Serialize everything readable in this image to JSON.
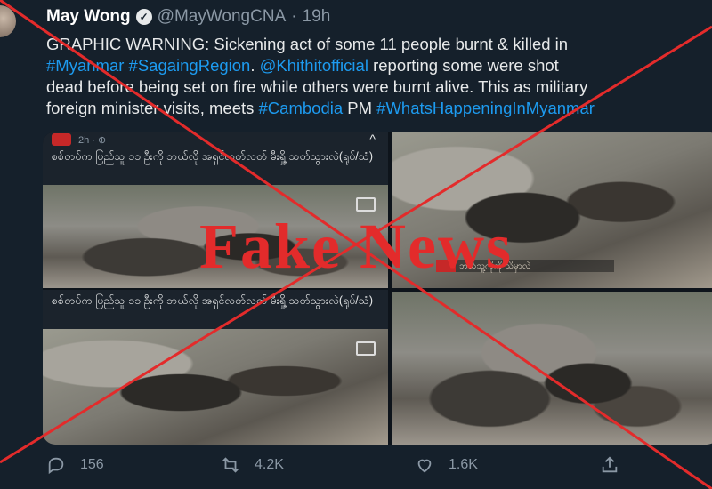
{
  "tweet": {
    "author_name": "May Wong",
    "handle": "@MayWongCNA",
    "separator": "·",
    "time": "19h",
    "verified_glyph": "✓",
    "text_lines": [
      [
        {
          "t": "GRAPHIC WARNING: Sickening act of some 11 people burnt & killed in",
          "link": false
        }
      ],
      [
        {
          "t": "#Myanmar",
          "link": true
        },
        {
          "t": " ",
          "link": false
        },
        {
          "t": "#SagaingRegion",
          "link": true
        },
        {
          "t": ". ",
          "link": false
        },
        {
          "t": "@Khithitofficial",
          "link": true
        },
        {
          "t": " reporting some were shot",
          "link": false
        }
      ],
      [
        {
          "t": "dead before being set on fire while others were burnt alive. This as military",
          "link": false
        }
      ],
      [
        {
          "t": "foreign minister visits, meets ",
          "link": false
        },
        {
          "t": "#Cambodia",
          "link": true
        },
        {
          "t": " PM ",
          "link": false
        },
        {
          "t": "#WhatsHappeningInMyanmar",
          "link": true
        }
      ]
    ]
  },
  "media": {
    "post_time": "2h · ⊕",
    "caption_1": "စစ်တပ်က ပြည်သူ ၁၁ ဦးကို ဘယ်လို အရှင်လတ်လတ် မီးရှို့ သတ်သွားလဲ(ရုပ်/သံ)",
    "caption_2": "စစ်တပ်က ပြည်သူ ၁၁ ဦးကို ဘယ်လို အရှင်လတ်လတ် မီးရှို့ သတ်သွားလဲ(ရုပ်/သံ)",
    "subtitle_text": "ဘယ်သူ့ကိုကို သိမှာလဲ",
    "collapse_glyph": "^"
  },
  "actions": {
    "reply_count": "156",
    "retweet_count": "4.2K",
    "like_count": "1.6K"
  },
  "overlay": {
    "stamp_text": "Fake News",
    "stamp_color": "#e32b2b"
  },
  "colors": {
    "background": "#15202b",
    "link": "#1d9bf0",
    "muted": "#8b98a5"
  },
  "icons": [
    "avatar",
    "verified-badge-icon",
    "cast-icon",
    "reply-icon",
    "retweet-icon",
    "like-icon",
    "share-icon"
  ]
}
